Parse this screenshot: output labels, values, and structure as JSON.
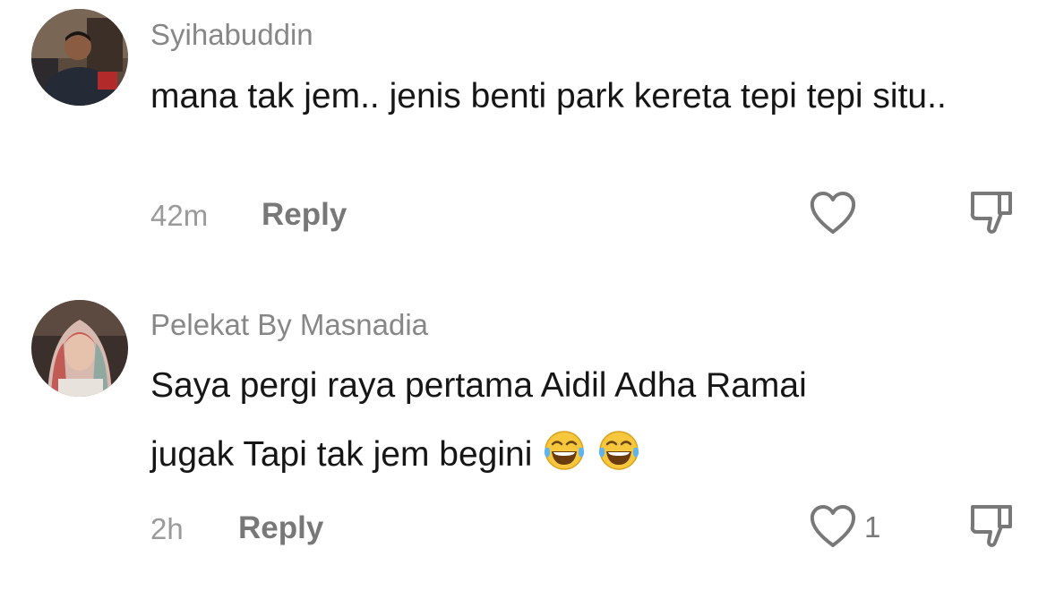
{
  "comments": [
    {
      "username": "Syihabuddin",
      "text": "mana tak jem.. jenis benti park kereta tepi tepi situ..",
      "time": "42m",
      "reply_label": "Reply",
      "like_count": ""
    },
    {
      "username": "Pelekat By Masnadia",
      "text_line1": "Saya pergi raya pertama Aidil Adha Ramai",
      "text_line2": "jugak Tapi tak jem begini",
      "emojis": [
        "😂",
        "😂"
      ],
      "time": "2h",
      "reply_label": "Reply",
      "like_count": "1"
    }
  ],
  "icons": {
    "like": "heart-outline-icon",
    "dislike": "thumbs-down-outline-icon"
  },
  "colors": {
    "username": "#878787",
    "text": "#161616",
    "meta": "#9a9a9a",
    "action": "#787878"
  }
}
